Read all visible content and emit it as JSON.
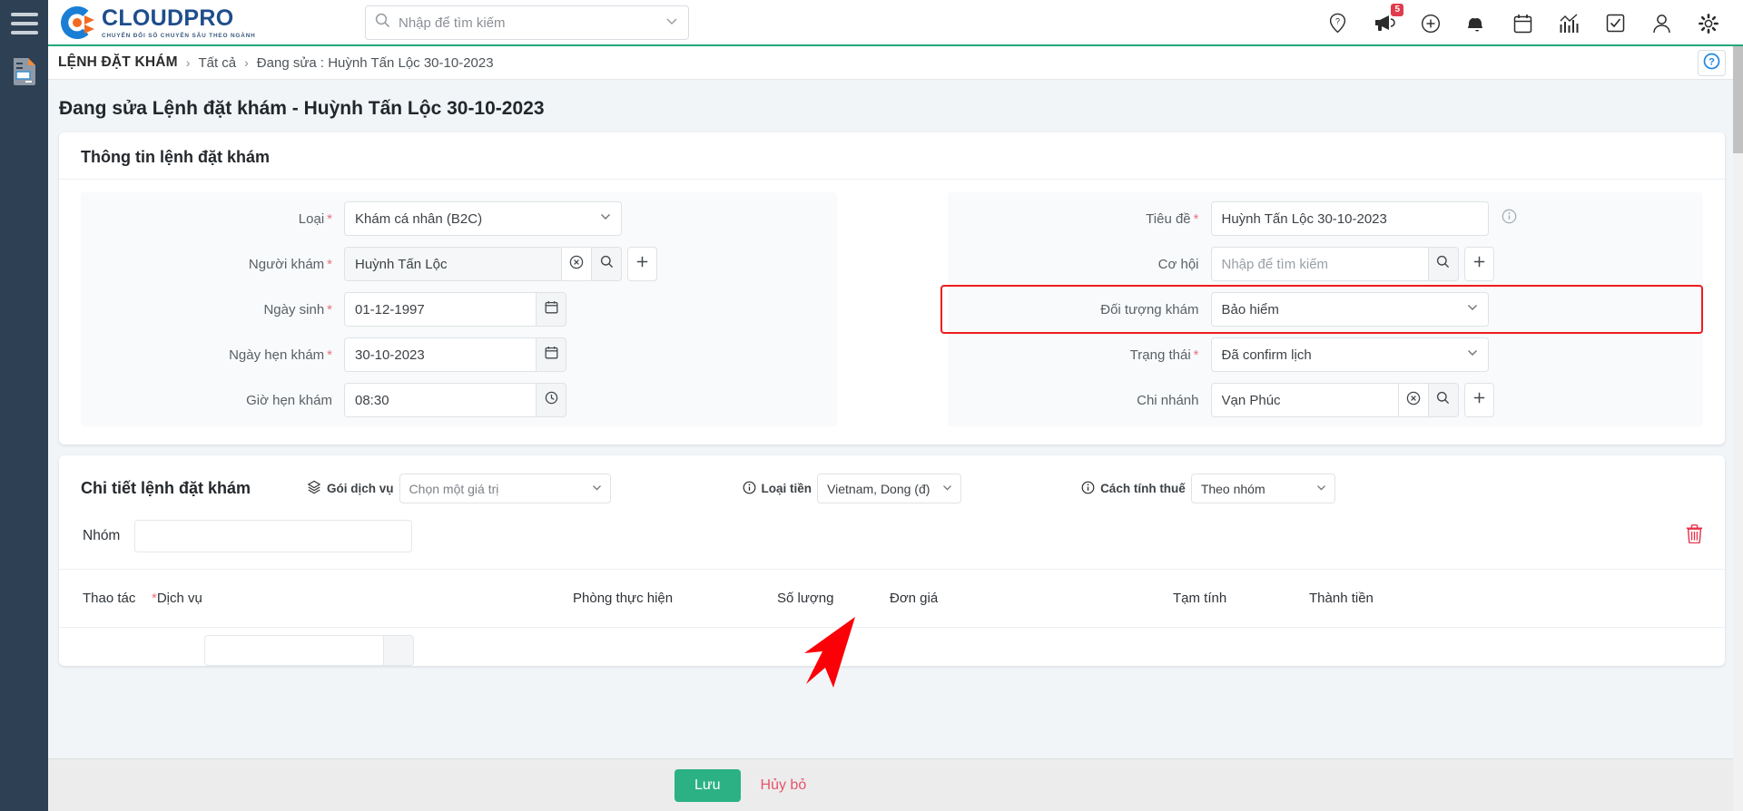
{
  "brand": {
    "name": "CLOUDPRO",
    "tagline": "CHUYỂN ĐỔI SỐ CHUYÊN SÂU THEO NGÀNH"
  },
  "search": {
    "placeholder": "Nhập để tìm kiếm",
    "value": ""
  },
  "topbar": {
    "icons": [
      {
        "name": "location-pin-help-icon",
        "label": "Hỗ trợ vị trí"
      },
      {
        "name": "megaphone-icon",
        "label": "Thông báo",
        "badge": "5"
      },
      {
        "name": "plus-circle-icon",
        "label": "Tạo mới"
      },
      {
        "name": "bell-icon",
        "label": "Nhắc nhở"
      },
      {
        "name": "calendar-icon",
        "label": "Lịch"
      },
      {
        "name": "chart-icon",
        "label": "Báo cáo"
      },
      {
        "name": "checkbox-icon",
        "label": "Công việc"
      },
      {
        "name": "user-icon",
        "label": "Tài khoản"
      },
      {
        "name": "gear-icon",
        "label": "Cài đặt"
      }
    ]
  },
  "breadcrumb": {
    "root": "LỆNH ĐẶT KHÁM",
    "separator": "›",
    "items": [
      "Tất cả",
      "Đang sửa : Huỳnh Tấn Lộc 30-10-2023"
    ]
  },
  "help_button": {
    "name": "help-circle-icon",
    "label": "?"
  },
  "page": {
    "title": "Đang sửa Lệnh đặt khám - Huỳnh Tấn Lộc 30-10-2023"
  },
  "info_card": {
    "title": "Thông tin lệnh đặt khám",
    "left_fields": [
      {
        "label": "Loại",
        "required": true,
        "type": "select",
        "value": "Khám cá nhân (B2C)"
      },
      {
        "label": "Người khám",
        "required": true,
        "type": "lookup",
        "value": "Huỳnh Tấn Lộc",
        "readonly": true,
        "has_clear": true,
        "has_search": true,
        "has_add": true
      },
      {
        "label": "Ngày sinh",
        "required": true,
        "type": "date",
        "value": "01-12-1997"
      },
      {
        "label": "Ngày hẹn khám",
        "required": true,
        "type": "date",
        "value": "30-10-2023"
      },
      {
        "label": "Giờ hẹn khám",
        "required": false,
        "type": "time",
        "value": "08:30"
      }
    ],
    "right_fields": [
      {
        "label": "Tiêu đề",
        "required": true,
        "type": "text",
        "value": "Huỳnh Tấn Lộc 30-10-2023",
        "has_info": true
      },
      {
        "label": "Cơ hội",
        "required": false,
        "type": "lookup",
        "value": "",
        "placeholder": "Nhập để tìm kiếm",
        "has_search": true,
        "has_add": true
      },
      {
        "label": "Đối tượng khám",
        "required": false,
        "type": "select",
        "value": "Bảo hiểm",
        "highlighted": true
      },
      {
        "label": "Trạng thái",
        "required": true,
        "type": "select",
        "value": "Đã confirm lịch"
      },
      {
        "label": "Chi nhánh",
        "required": false,
        "type": "lookup",
        "value": "Vạn Phúc",
        "has_clear": true,
        "has_search": true,
        "has_add": true
      }
    ]
  },
  "detail_card": {
    "title": "Chi tiết lệnh đặt khám",
    "service_package": {
      "icon": "package-icon",
      "label": "Gói dịch vụ",
      "value": "Chọn một giá trị"
    },
    "currency": {
      "icon": "info-circle-icon",
      "label": "Loại tiền",
      "value": "Vietnam, Dong (đ)"
    },
    "tax_mode": {
      "icon": "info-circle-icon",
      "label": "Cách tính thuế",
      "value": "Theo nhóm"
    },
    "group_row": {
      "label": "Nhóm",
      "value": "",
      "delete_icon": "trash-icon"
    },
    "table": {
      "columns": [
        {
          "key": "action",
          "label": "Thao tác",
          "required": false
        },
        {
          "key": "service",
          "label": "Dịch vụ",
          "required": true
        },
        {
          "key": "room",
          "label": "Phòng thực hiện",
          "required": false
        },
        {
          "key": "qty",
          "label": "Số lượng",
          "required": false
        },
        {
          "key": "unit_price",
          "label": "Đơn giá",
          "required": false
        },
        {
          "key": "subtotal",
          "label": "Tạm tính",
          "required": false
        },
        {
          "key": "total",
          "label": "Thành tiền",
          "required": false
        }
      ],
      "rows": []
    }
  },
  "footer": {
    "save_label": "Lưu",
    "cancel_label": "Hủy bỏ"
  },
  "colors": {
    "brand_blue": "#1e4d8c",
    "accent_green": "#20a97a",
    "save_green": "#2bb184",
    "cancel_red": "#e8536b",
    "highlight_red": "#f01b1b",
    "badge_red": "#e03b4d",
    "rail_dark": "#2e4054"
  }
}
